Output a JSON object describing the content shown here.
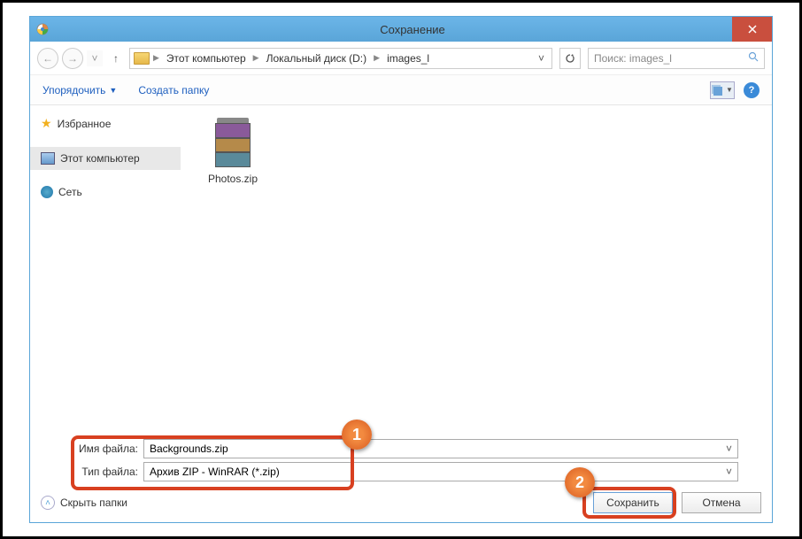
{
  "window": {
    "title": "Сохранение"
  },
  "nav": {
    "crumbs": [
      "Этот компьютер",
      "Локальный диск (D:)",
      "images_l"
    ],
    "search_placeholder": "Поиск: images_l"
  },
  "toolbar": {
    "organize": "Упорядочить",
    "new_folder": "Создать папку"
  },
  "sidebar": {
    "favorites": "Избранное",
    "this_pc": "Этот компьютер",
    "network": "Сеть"
  },
  "files": [
    {
      "name": "Photos.zip"
    }
  ],
  "fields": {
    "filename_label": "Имя файла:",
    "filename_value": "Backgrounds.zip",
    "filetype_label": "Тип файла:",
    "filetype_value": "Архив ZIP - WinRAR (*.zip)"
  },
  "footer": {
    "hide_folders": "Скрыть папки",
    "save": "Сохранить",
    "cancel": "Отмена"
  },
  "annotations": {
    "b1": "1",
    "b2": "2"
  }
}
